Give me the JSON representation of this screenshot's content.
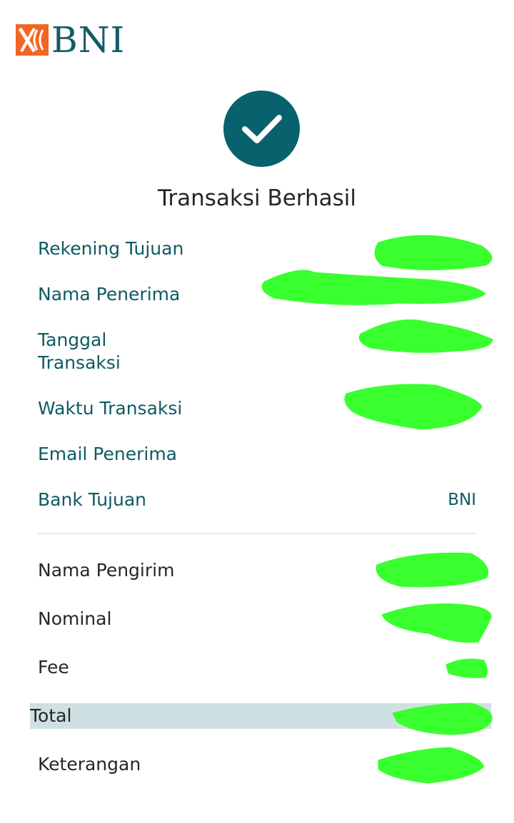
{
  "brand": {
    "logo_text": "BNI"
  },
  "status": {
    "title": "Transaksi Berhasil",
    "icon": "checkmark-icon"
  },
  "recipient_details": [
    {
      "label": "Rekening Tujuan",
      "value": ""
    },
    {
      "label": "Nama Penerima",
      "value": ""
    },
    {
      "label": "Tanggal Transaksi",
      "value": ""
    },
    {
      "label": "Waktu Transaksi",
      "value": ""
    },
    {
      "label": "Email Penerima",
      "value": ""
    },
    {
      "label": "Bank Tujuan",
      "value": "BNI"
    }
  ],
  "payment_details": [
    {
      "label": "Nama Pengirim",
      "value": ""
    },
    {
      "label": "Nominal",
      "value": ""
    },
    {
      "label": "Fee",
      "value": ""
    },
    {
      "label": "Total",
      "value": ""
    },
    {
      "label": "Keterangan",
      "value": ""
    }
  ],
  "colors": {
    "brand_teal": "#08626d",
    "brand_orange": "#f26522",
    "label_teal": "#0f5a62",
    "total_highlight": "#cfe0e3",
    "redaction_green": "#39ff2e"
  }
}
